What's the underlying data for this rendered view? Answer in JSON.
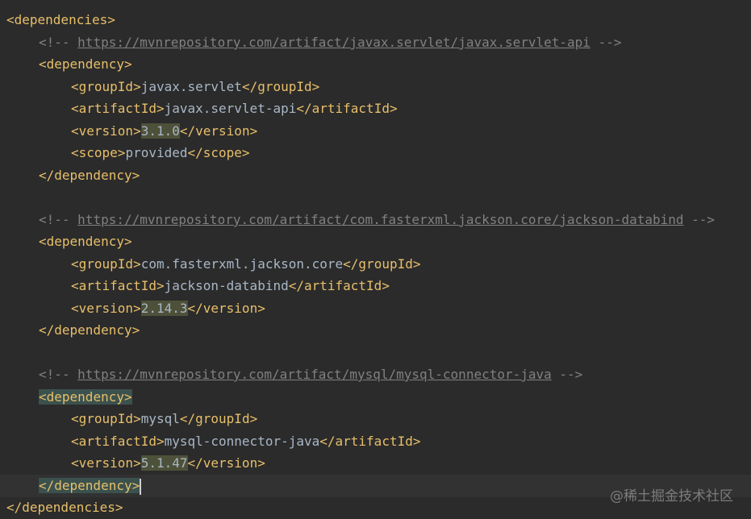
{
  "code_lines": [
    {
      "id": "l1",
      "parts": [
        "<dependencies>"
      ]
    },
    {
      "id": "l2",
      "comment_open": "<!-- ",
      "url": "https://mvnrepository.com/artifact/javax.servlet/javax.servlet-api",
      "comment_close": " -->"
    },
    {
      "id": "l3",
      "text": "<dependency>"
    },
    {
      "id": "l4",
      "open": "<groupId>",
      "value": "javax.servlet",
      "close": "</groupId>"
    },
    {
      "id": "l5",
      "open": "<artifactId>",
      "value": "javax.servlet-api",
      "close": "</artifactId>"
    },
    {
      "id": "l6",
      "open": "<version>",
      "value": "3.1.0",
      "close": "</version>"
    },
    {
      "id": "l7",
      "open": "<scope>",
      "value": "provided",
      "close": "</scope>"
    },
    {
      "id": "l8",
      "text": "</dependency>"
    },
    {
      "id": "l9",
      "comment_open": "<!-- ",
      "url": "https://mvnrepository.com/artifact/com.fasterxml.jackson.core/jackson-databind",
      "comment_close": " -->"
    },
    {
      "id": "l10",
      "text": "<dependency>"
    },
    {
      "id": "l11",
      "open": "<groupId>",
      "value": "com.fasterxml.jackson.core",
      "close": "</groupId>"
    },
    {
      "id": "l12",
      "open": "<artifactId>",
      "value": "jackson-databind",
      "close": "</artifactId>"
    },
    {
      "id": "l13",
      "open": "<version>",
      "value": "2.14.3",
      "close": "</version>"
    },
    {
      "id": "l14",
      "text": "</dependency>"
    },
    {
      "id": "l15",
      "comment_open": "<!-- ",
      "url": "https://mvnrepository.com/artifact/mysql/mysql-connector-java",
      "comment_close": " -->"
    },
    {
      "id": "l16",
      "lt": "<",
      "text": "dependency>"
    },
    {
      "id": "l17",
      "open": "<groupId>",
      "value": "mysql",
      "close": "</groupId>"
    },
    {
      "id": "l18",
      "open": "<artifactId>",
      "value": "mysql-connector-java",
      "close": "</artifactId>"
    },
    {
      "id": "l19",
      "open": "<version>",
      "value": "5.1.47",
      "close": "</version>"
    },
    {
      "id": "l20",
      "text": "</dependency",
      "gt": ">"
    },
    {
      "id": "l21",
      "text": "</dependencies>"
    }
  ],
  "watermark": "@稀土掘金技术社区",
  "colors": {
    "background": "#2b2b2b",
    "tag": "#e8bf6a",
    "text": "#a9b7c6",
    "comment": "#808080",
    "version_highlight": "#4e5139",
    "tag_highlight": "#3b514d",
    "current_line": "#323232"
  }
}
